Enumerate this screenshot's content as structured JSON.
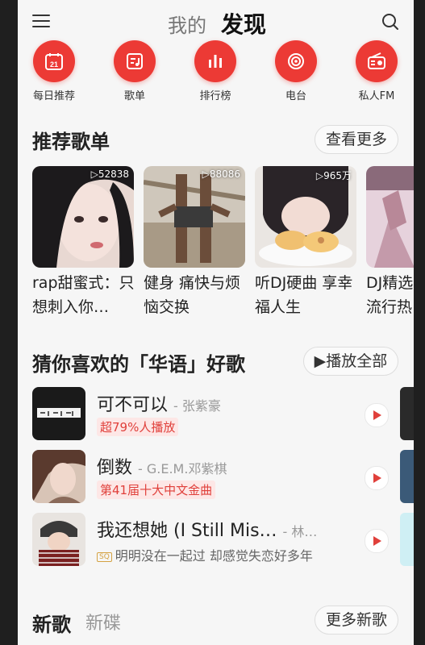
{
  "header": {
    "tab_mine": "我的",
    "tab_discover": "发现"
  },
  "quick_entries": [
    {
      "label": "每日推荐",
      "icon": "calendar-icon",
      "day": "21"
    },
    {
      "label": "歌单",
      "icon": "playlist-icon"
    },
    {
      "label": "排行榜",
      "icon": "chart-bars-icon"
    },
    {
      "label": "电台",
      "icon": "podcast-icon"
    },
    {
      "label": "私人FM",
      "icon": "radio-icon"
    }
  ],
  "recommended": {
    "title": "推荐歌单",
    "more_label": "查看更多",
    "playlists": [
      {
        "count": "52838",
        "title": "rap甜蜜式：只想刺入你…"
      },
      {
        "count": "88086",
        "title": "健身 痛快与烦恼交换"
      },
      {
        "count": "965万",
        "title": "听DJ硬曲 享幸福人生"
      },
      {
        "count": "",
        "title": "DJ精选 流行热"
      }
    ]
  },
  "guess": {
    "title": "猜你喜欢的「华语」好歌",
    "play_all_label": "播放全部",
    "songs": [
      {
        "title": "可不可以",
        "artist": "- 张紫豪",
        "tag": "超79%人播放"
      },
      {
        "title": "倒数",
        "artist": "- G.E.M.邓紫棋",
        "tag": "第41届十大中文金曲"
      },
      {
        "title": "我还想她 (I Still Mis…",
        "artist": "- 林…",
        "badge": "SQ",
        "subtitle": "明明没在一起过 却感觉失恋好多年"
      }
    ]
  },
  "new_section": {
    "tab_songs": "新歌",
    "tab_albums": "新碟",
    "more_label": "更多新歌"
  },
  "colors": {
    "accent": "#ec3a35",
    "tag_bg": "#fde7e6",
    "background": "#f6f6f6"
  }
}
